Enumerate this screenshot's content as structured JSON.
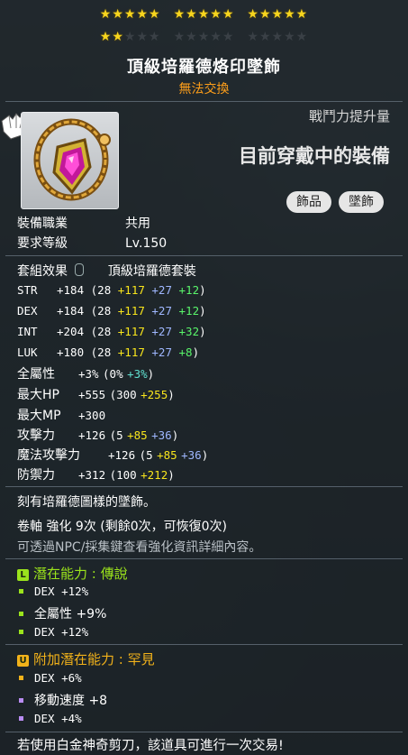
{
  "stars": {
    "filled": 17,
    "total": 25
  },
  "item": {
    "name": "頂級培羅德烙印墜飾",
    "trade_status": "無法交換",
    "power_label": "戰鬥力提升量",
    "equipped_text": "目前穿戴中的裝備",
    "tags": [
      "飾品",
      "墜飾"
    ]
  },
  "info": {
    "job_label": "裝備職業",
    "job_value": "共用",
    "level_label": "要求等級",
    "level_value": "Lv.150",
    "set_label": "套組效果",
    "set_value": "頂級培羅德套裝"
  },
  "stats": [
    {
      "name": "STR",
      "total": "+184",
      "base": "28",
      "flame": "+117",
      "scroll": "+27",
      "extra": "+12"
    },
    {
      "name": "DEX",
      "total": "+184",
      "base": "28",
      "flame": "+117",
      "scroll": "+27",
      "extra": "+12"
    },
    {
      "name": "INT",
      "total": "+204",
      "base": "28",
      "flame": "+117",
      "scroll": "+27",
      "extra": "+32"
    },
    {
      "name": "LUK",
      "total": "+180",
      "base": "28",
      "flame": "+117",
      "scroll": "+27",
      "extra": "+8"
    }
  ],
  "stats2": {
    "allstat_label": "全屬性",
    "allstat_total": "+3%",
    "allstat_base": "(0%",
    "allstat_extra": "+3%",
    "hp_label": "最大HP",
    "hp_total": "+555",
    "hp_base": "(300",
    "hp_extra": "+255",
    "mp_label": "最大MP",
    "mp_total": "+300",
    "atk_label": "攻擊力",
    "atk_total": "+126",
    "atk_base": "(5",
    "atk_scroll": "+85",
    "atk_extra": "+36",
    "matk_label": "魔法攻擊力",
    "matk_total": "+126",
    "matk_base": "(5",
    "matk_scroll": "+85",
    "matk_extra": "+36",
    "def_label": "防禦力",
    "def_total": "+312",
    "def_base": "(100",
    "def_extra": "+212",
    "close_paren": ")"
  },
  "desc": {
    "engraved": "刻有培羅德圖樣的墜飾。",
    "scroll": "卷軸 強化 9次 (剩餘0次，可恢復0次)",
    "hint": "可透過NPC/採集鍵查看強化資訊詳細內容。"
  },
  "potential": {
    "badge": "L",
    "head": "潛在能力 : 傳說",
    "color": "#9be31c",
    "lines": [
      "DEX +12%",
      "全屬性 +9%",
      "DEX +12%"
    ]
  },
  "additional": {
    "badge": "U",
    "head": "附加潛在能力 : 罕見",
    "color": "#f2b21a",
    "lines": [
      {
        "text": "DEX +6%",
        "bullet": "#f2b21a"
      },
      {
        "text": "移動速度 +8",
        "bullet": "#b98cf2"
      },
      {
        "text": "DEX +4%",
        "bullet": "#b98cf2"
      }
    ]
  },
  "footer": "若使用白金神奇剪刀，該道具可進行一次交易!"
}
